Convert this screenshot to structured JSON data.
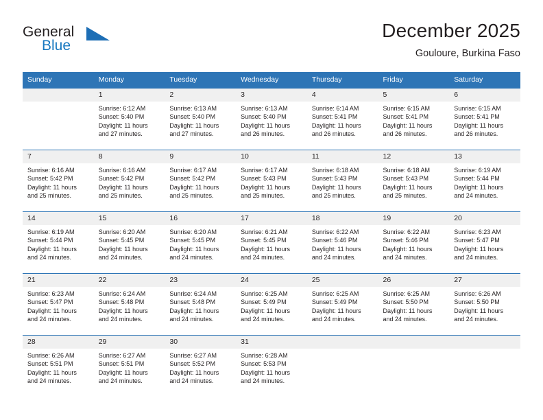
{
  "brand": {
    "name_top": "General",
    "name_bottom": "Blue",
    "accent_color": "#1878c0",
    "triangle_color": "#1d6eb5"
  },
  "header": {
    "title": "December 2025",
    "subtitle": "Gouloure, Burkina Faso",
    "header_bg": "#2e75b6",
    "daynum_bg": "#f0f0f0"
  },
  "weekday_headers": [
    "Sunday",
    "Monday",
    "Tuesday",
    "Wednesday",
    "Thursday",
    "Friday",
    "Saturday"
  ],
  "weeks": [
    [
      {
        "day": "",
        "sunrise": "",
        "sunset": "",
        "daylight1": "",
        "daylight2": ""
      },
      {
        "day": "1",
        "sunrise": "Sunrise: 6:12 AM",
        "sunset": "Sunset: 5:40 PM",
        "daylight1": "Daylight: 11 hours",
        "daylight2": "and 27 minutes."
      },
      {
        "day": "2",
        "sunrise": "Sunrise: 6:13 AM",
        "sunset": "Sunset: 5:40 PM",
        "daylight1": "Daylight: 11 hours",
        "daylight2": "and 27 minutes."
      },
      {
        "day": "3",
        "sunrise": "Sunrise: 6:13 AM",
        "sunset": "Sunset: 5:40 PM",
        "daylight1": "Daylight: 11 hours",
        "daylight2": "and 26 minutes."
      },
      {
        "day": "4",
        "sunrise": "Sunrise: 6:14 AM",
        "sunset": "Sunset: 5:41 PM",
        "daylight1": "Daylight: 11 hours",
        "daylight2": "and 26 minutes."
      },
      {
        "day": "5",
        "sunrise": "Sunrise: 6:15 AM",
        "sunset": "Sunset: 5:41 PM",
        "daylight1": "Daylight: 11 hours",
        "daylight2": "and 26 minutes."
      },
      {
        "day": "6",
        "sunrise": "Sunrise: 6:15 AM",
        "sunset": "Sunset: 5:41 PM",
        "daylight1": "Daylight: 11 hours",
        "daylight2": "and 26 minutes."
      }
    ],
    [
      {
        "day": "7",
        "sunrise": "Sunrise: 6:16 AM",
        "sunset": "Sunset: 5:42 PM",
        "daylight1": "Daylight: 11 hours",
        "daylight2": "and 25 minutes."
      },
      {
        "day": "8",
        "sunrise": "Sunrise: 6:16 AM",
        "sunset": "Sunset: 5:42 PM",
        "daylight1": "Daylight: 11 hours",
        "daylight2": "and 25 minutes."
      },
      {
        "day": "9",
        "sunrise": "Sunrise: 6:17 AM",
        "sunset": "Sunset: 5:42 PM",
        "daylight1": "Daylight: 11 hours",
        "daylight2": "and 25 minutes."
      },
      {
        "day": "10",
        "sunrise": "Sunrise: 6:17 AM",
        "sunset": "Sunset: 5:43 PM",
        "daylight1": "Daylight: 11 hours",
        "daylight2": "and 25 minutes."
      },
      {
        "day": "11",
        "sunrise": "Sunrise: 6:18 AM",
        "sunset": "Sunset: 5:43 PM",
        "daylight1": "Daylight: 11 hours",
        "daylight2": "and 25 minutes."
      },
      {
        "day": "12",
        "sunrise": "Sunrise: 6:18 AM",
        "sunset": "Sunset: 5:43 PM",
        "daylight1": "Daylight: 11 hours",
        "daylight2": "and 25 minutes."
      },
      {
        "day": "13",
        "sunrise": "Sunrise: 6:19 AM",
        "sunset": "Sunset: 5:44 PM",
        "daylight1": "Daylight: 11 hours",
        "daylight2": "and 24 minutes."
      }
    ],
    [
      {
        "day": "14",
        "sunrise": "Sunrise: 6:19 AM",
        "sunset": "Sunset: 5:44 PM",
        "daylight1": "Daylight: 11 hours",
        "daylight2": "and 24 minutes."
      },
      {
        "day": "15",
        "sunrise": "Sunrise: 6:20 AM",
        "sunset": "Sunset: 5:45 PM",
        "daylight1": "Daylight: 11 hours",
        "daylight2": "and 24 minutes."
      },
      {
        "day": "16",
        "sunrise": "Sunrise: 6:20 AM",
        "sunset": "Sunset: 5:45 PM",
        "daylight1": "Daylight: 11 hours",
        "daylight2": "and 24 minutes."
      },
      {
        "day": "17",
        "sunrise": "Sunrise: 6:21 AM",
        "sunset": "Sunset: 5:45 PM",
        "daylight1": "Daylight: 11 hours",
        "daylight2": "and 24 minutes."
      },
      {
        "day": "18",
        "sunrise": "Sunrise: 6:22 AM",
        "sunset": "Sunset: 5:46 PM",
        "daylight1": "Daylight: 11 hours",
        "daylight2": "and 24 minutes."
      },
      {
        "day": "19",
        "sunrise": "Sunrise: 6:22 AM",
        "sunset": "Sunset: 5:46 PM",
        "daylight1": "Daylight: 11 hours",
        "daylight2": "and 24 minutes."
      },
      {
        "day": "20",
        "sunrise": "Sunrise: 6:23 AM",
        "sunset": "Sunset: 5:47 PM",
        "daylight1": "Daylight: 11 hours",
        "daylight2": "and 24 minutes."
      }
    ],
    [
      {
        "day": "21",
        "sunrise": "Sunrise: 6:23 AM",
        "sunset": "Sunset: 5:47 PM",
        "daylight1": "Daylight: 11 hours",
        "daylight2": "and 24 minutes."
      },
      {
        "day": "22",
        "sunrise": "Sunrise: 6:24 AM",
        "sunset": "Sunset: 5:48 PM",
        "daylight1": "Daylight: 11 hours",
        "daylight2": "and 24 minutes."
      },
      {
        "day": "23",
        "sunrise": "Sunrise: 6:24 AM",
        "sunset": "Sunset: 5:48 PM",
        "daylight1": "Daylight: 11 hours",
        "daylight2": "and 24 minutes."
      },
      {
        "day": "24",
        "sunrise": "Sunrise: 6:25 AM",
        "sunset": "Sunset: 5:49 PM",
        "daylight1": "Daylight: 11 hours",
        "daylight2": "and 24 minutes."
      },
      {
        "day": "25",
        "sunrise": "Sunrise: 6:25 AM",
        "sunset": "Sunset: 5:49 PM",
        "daylight1": "Daylight: 11 hours",
        "daylight2": "and 24 minutes."
      },
      {
        "day": "26",
        "sunrise": "Sunrise: 6:25 AM",
        "sunset": "Sunset: 5:50 PM",
        "daylight1": "Daylight: 11 hours",
        "daylight2": "and 24 minutes."
      },
      {
        "day": "27",
        "sunrise": "Sunrise: 6:26 AM",
        "sunset": "Sunset: 5:50 PM",
        "daylight1": "Daylight: 11 hours",
        "daylight2": "and 24 minutes."
      }
    ],
    [
      {
        "day": "28",
        "sunrise": "Sunrise: 6:26 AM",
        "sunset": "Sunset: 5:51 PM",
        "daylight1": "Daylight: 11 hours",
        "daylight2": "and 24 minutes."
      },
      {
        "day": "29",
        "sunrise": "Sunrise: 6:27 AM",
        "sunset": "Sunset: 5:51 PM",
        "daylight1": "Daylight: 11 hours",
        "daylight2": "and 24 minutes."
      },
      {
        "day": "30",
        "sunrise": "Sunrise: 6:27 AM",
        "sunset": "Sunset: 5:52 PM",
        "daylight1": "Daylight: 11 hours",
        "daylight2": "and 24 minutes."
      },
      {
        "day": "31",
        "sunrise": "Sunrise: 6:28 AM",
        "sunset": "Sunset: 5:53 PM",
        "daylight1": "Daylight: 11 hours",
        "daylight2": "and 24 minutes."
      },
      {
        "day": "",
        "sunrise": "",
        "sunset": "",
        "daylight1": "",
        "daylight2": ""
      },
      {
        "day": "",
        "sunrise": "",
        "sunset": "",
        "daylight1": "",
        "daylight2": ""
      },
      {
        "day": "",
        "sunrise": "",
        "sunset": "",
        "daylight1": "",
        "daylight2": ""
      }
    ]
  ]
}
